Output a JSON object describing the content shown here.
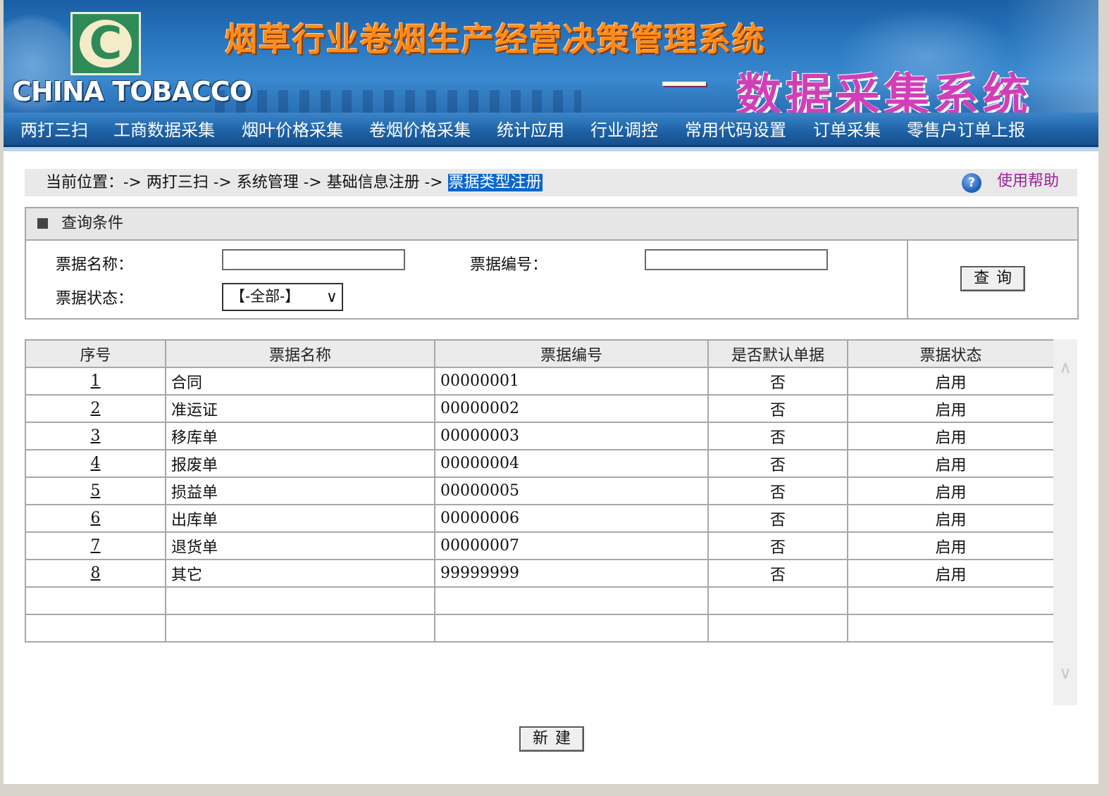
{
  "header": {
    "logo_letter": "C",
    "brand": "CHINA TOBACCO",
    "title_main": "烟草行业卷烟生产经营决策管理系统",
    "title_sub": "数据采集系统"
  },
  "nav": {
    "items": [
      {
        "label": "两打三扫"
      },
      {
        "label": "工商数据采集"
      },
      {
        "label": "烟叶价格采集"
      },
      {
        "label": "卷烟价格采集"
      },
      {
        "label": "统计应用"
      },
      {
        "label": "行业调控"
      },
      {
        "label": "常用代码设置"
      },
      {
        "label": "订单采集"
      },
      {
        "label": "零售户订单上报"
      }
    ]
  },
  "breadcrumb": {
    "prefix": "当前位置：->",
    "items": [
      "两打三扫",
      "系统管理",
      "基础信息注册"
    ],
    "separator": "->",
    "current": "票据类型注册",
    "help_label": "使用帮助",
    "help_icon": "question-icon"
  },
  "query": {
    "title": "查询条件",
    "name_label": "票据名称：",
    "name_value": "",
    "code_label": "票据编号：",
    "code_value": "",
    "status_label": "票据状态：",
    "status_selected": "【-全部-】",
    "search_button": "查询"
  },
  "table": {
    "headers": [
      "序号",
      "票据名称",
      "票据编号",
      "是否默认单据",
      "票据状态"
    ],
    "rows": [
      {
        "no": "1",
        "name": "合同",
        "code": "00000001",
        "default": "否",
        "status": "启用"
      },
      {
        "no": "2",
        "name": "准运证",
        "code": "00000002",
        "default": "否",
        "status": "启用"
      },
      {
        "no": "3",
        "name": "移库单",
        "code": "00000003",
        "default": "否",
        "status": "启用"
      },
      {
        "no": "4",
        "name": "报废单",
        "code": "00000004",
        "default": "否",
        "status": "启用"
      },
      {
        "no": "5",
        "name": "损益单",
        "code": "00000005",
        "default": "否",
        "status": "启用"
      },
      {
        "no": "6",
        "name": "出库单",
        "code": "00000006",
        "default": "否",
        "status": "启用"
      },
      {
        "no": "7",
        "name": "退货单",
        "code": "00000007",
        "default": "否",
        "status": "启用"
      },
      {
        "no": "8",
        "name": "其它",
        "code": "99999999",
        "default": "否",
        "status": "启用"
      }
    ],
    "empty_rows": 2
  },
  "actions": {
    "new_button": "新建"
  },
  "colors": {
    "nav_bg": "#1f63a8",
    "breadcrumb_current_bg": "#0a66cc",
    "help_link": "#a0209a",
    "title_main": "#ff8c1a",
    "title_sub": "#d13fb8"
  }
}
